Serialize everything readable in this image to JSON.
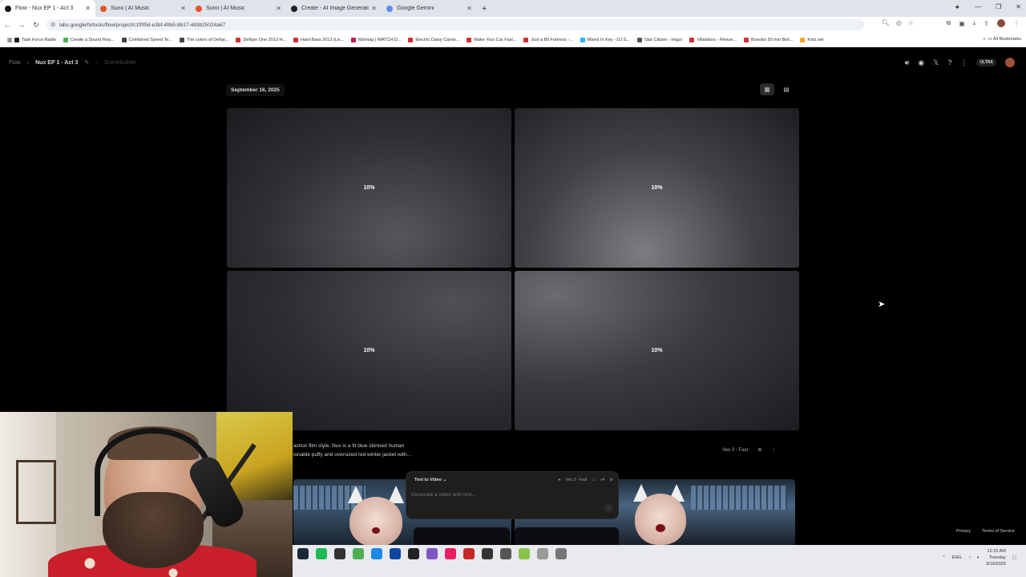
{
  "browser": {
    "tabs": [
      {
        "title": "Flow - Nux EP 1 - Act 3",
        "fav": "#111111",
        "active": true
      },
      {
        "title": "Suno | AI Music",
        "fav": "#e8542a",
        "active": false
      },
      {
        "title": "Suno | AI Music",
        "fav": "#e8542a",
        "active": false
      },
      {
        "title": "Create - AI Image Generator | L",
        "fav": "#222222",
        "active": false
      },
      {
        "title": "Google Gemini",
        "fav": "#5b8def",
        "active": false
      }
    ],
    "new_tab": "+",
    "url": "labs.google/fx/tools/flow/project/c1f0f5d-e3bf-49b5-8b17-483b25024a67",
    "bookmarks": [
      {
        "label": "Task Force Radio",
        "color": "#222"
      },
      {
        "label": "Create a Sound Rea...",
        "color": "#4caf50"
      },
      {
        "label": "Combined Speed Te...",
        "color": "#444"
      },
      {
        "label": "The colors of Defqo...",
        "color": "#444"
      },
      {
        "label": "Defqon One 2013 H...",
        "color": "#d32f2f"
      },
      {
        "label": "Hard Bass 2013 (Liv...",
        "color": "#d32f2f"
      },
      {
        "label": "Mixmag | WATCH D...",
        "color": "#c2185b"
      },
      {
        "label": "Electric Daisy Carniv...",
        "color": "#d32f2f"
      },
      {
        "label": "Make Your Car Fast...",
        "color": "#d32f2f"
      },
      {
        "label": "Just a Bit Fortress -...",
        "color": "#d32f2f"
      },
      {
        "label": "Mixed In Key - DJ S...",
        "color": "#29b6f6"
      },
      {
        "label": "Star Citizen - Imgur",
        "color": "#555"
      },
      {
        "label": "Villalobos - Fiheue...",
        "color": "#d32f2f"
      },
      {
        "label": "Bonobo 50 min Boil...",
        "color": "#d32f2f"
      },
      {
        "label": "Kritz.net",
        "color": "#f9a825"
      }
    ],
    "all_bookmarks": "All Bookmarks"
  },
  "app": {
    "breadcrumb": {
      "root": "Flow",
      "project": "Nux EP 1 - Act 3",
      "page": "Scenebuilder"
    },
    "ultra_badge": "ULTRA",
    "date": "September 16, 2025",
    "tiles": [
      {
        "progress": "10%"
      },
      {
        "progress": "10%"
      },
      {
        "progress": "10%"
      },
      {
        "progress": "10%"
      }
    ],
    "prompt_line1": "action film style. Nux is a fit blue skinned human",
    "prompt_line2": "ionable puffy and oversized red winter jacket with...",
    "model_label": "Veo 3 - Fast",
    "composer": {
      "mode": "Text to Video",
      "model": "Veo 3 - Fast",
      "count": "x4",
      "placeholder": "Generate a video with text..."
    },
    "footer": {
      "privacy": "Privacy",
      "terms": "Terms of Service"
    }
  },
  "taskbar": {
    "lang": "ENG",
    "time": "12:15 AM",
    "day": "Tuesday",
    "date": "9/16/2025",
    "icons": [
      "#1b2838",
      "#1db954",
      "#333",
      "#4caf50",
      "#1e88e5",
      "#0d47a1",
      "#222",
      "#7e57c2",
      "#e91e63",
      "#c62828",
      "#333",
      "#555",
      "#8bc34a",
      "#999",
      "#777"
    ]
  }
}
